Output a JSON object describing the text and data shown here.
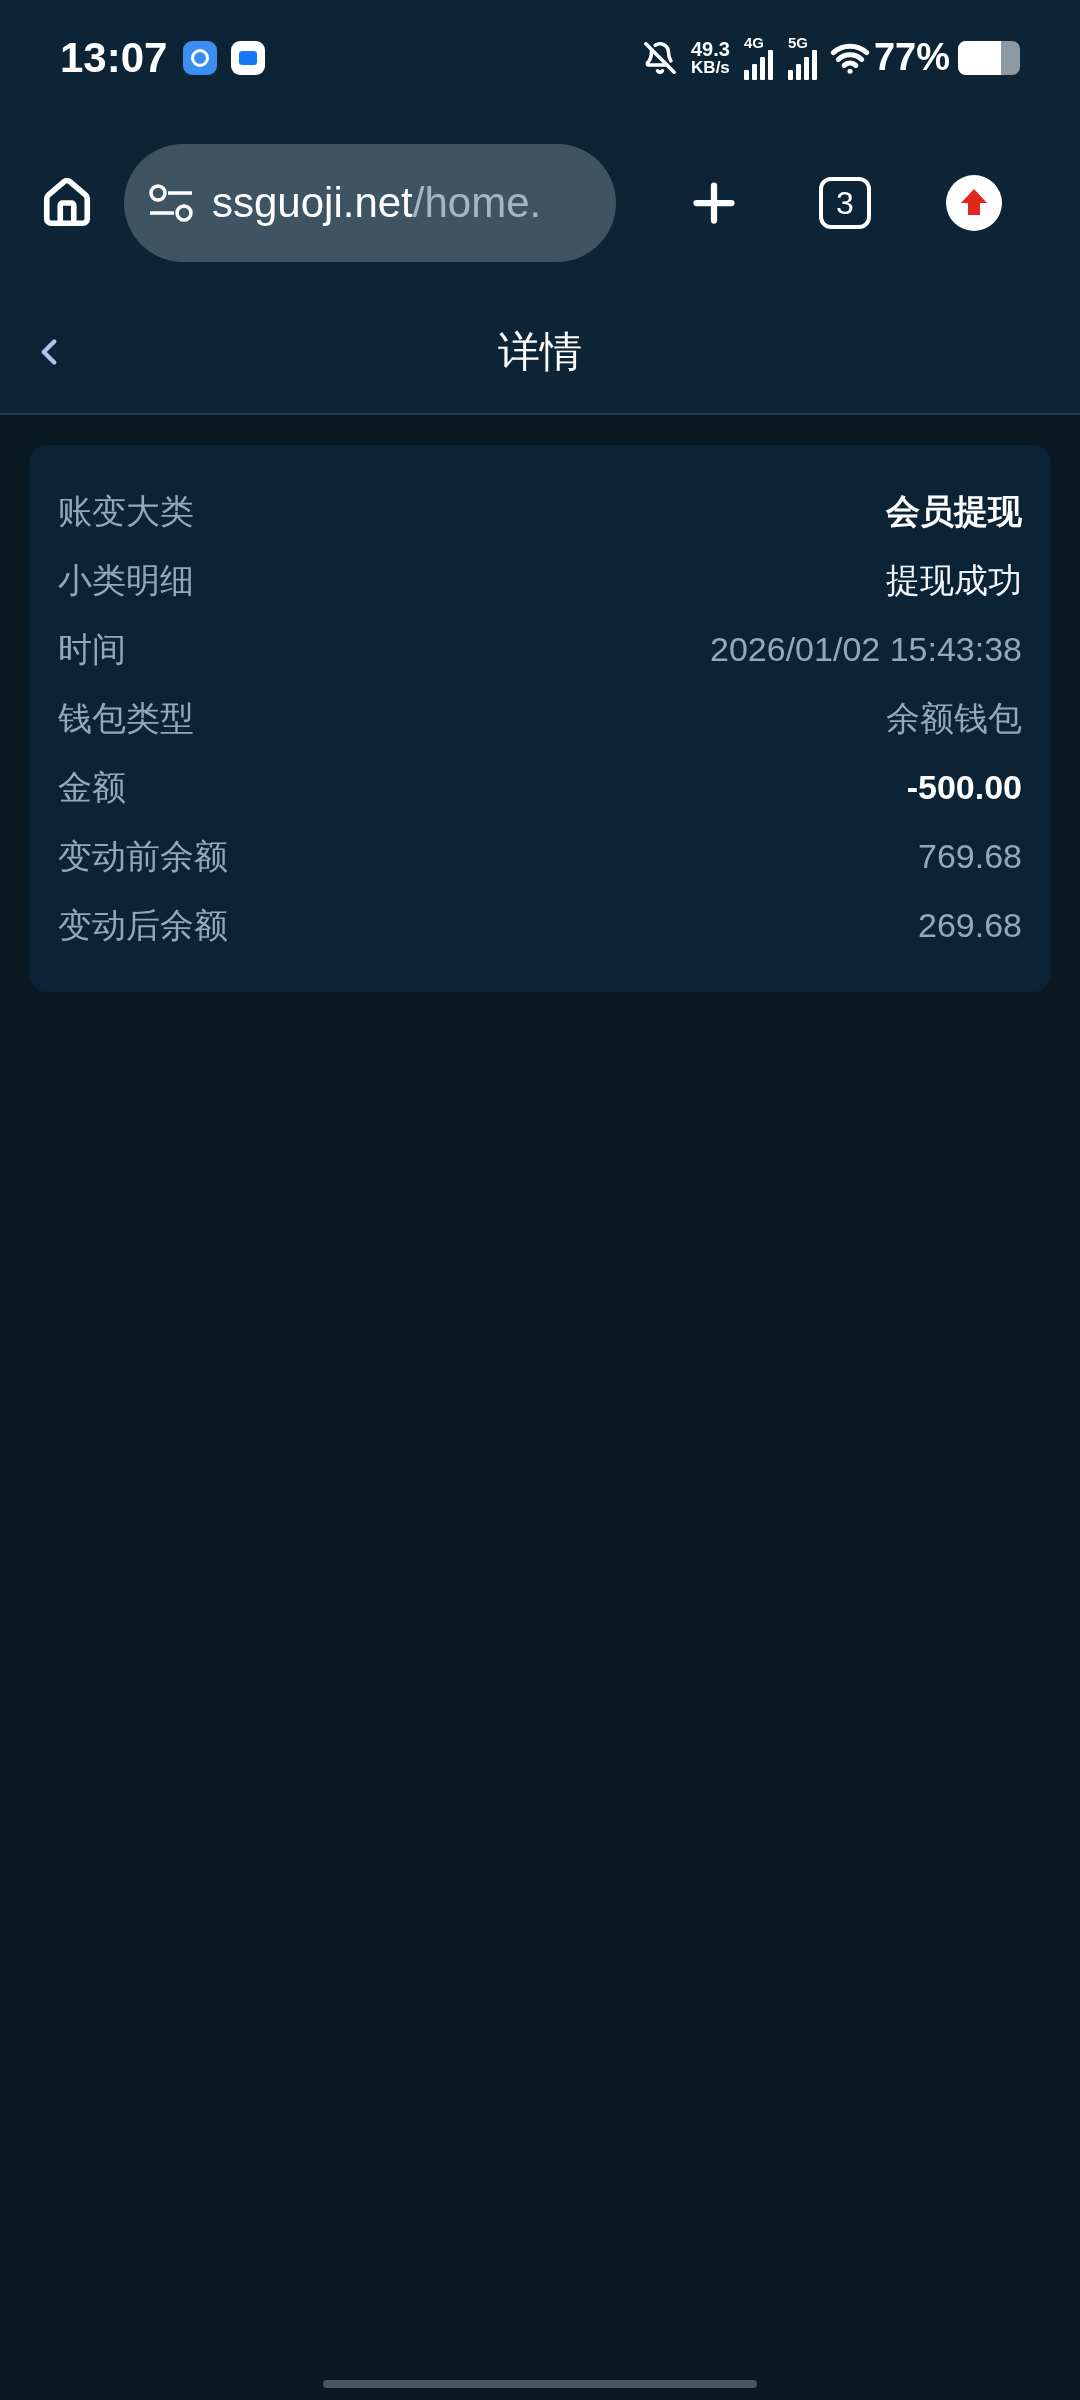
{
  "status_bar": {
    "time": "13:07",
    "speed_value": "49.3",
    "speed_unit": "KB/s",
    "network_1": "4G",
    "network_2": "5G",
    "battery": "77%"
  },
  "browser": {
    "url_host": "ssguoji.net",
    "url_path": "/home.",
    "tab_count": "3"
  },
  "header": {
    "title": "详情"
  },
  "details": [
    {
      "label": "账变大类",
      "value": "会员提现",
      "kind": "bold"
    },
    {
      "label": "小类明细",
      "value": "提现成功",
      "kind": "bright"
    },
    {
      "label": "时间",
      "value": "2026/01/02 15:43:38",
      "kind": "muted"
    },
    {
      "label": "钱包类型",
      "value": "余额钱包",
      "kind": "muted"
    },
    {
      "label": "金额",
      "value": "-500.00",
      "kind": "bold"
    },
    {
      "label": "变动前余额",
      "value": "769.68",
      "kind": "muted"
    },
    {
      "label": "变动后余额",
      "value": "269.68",
      "kind": "muted"
    }
  ]
}
